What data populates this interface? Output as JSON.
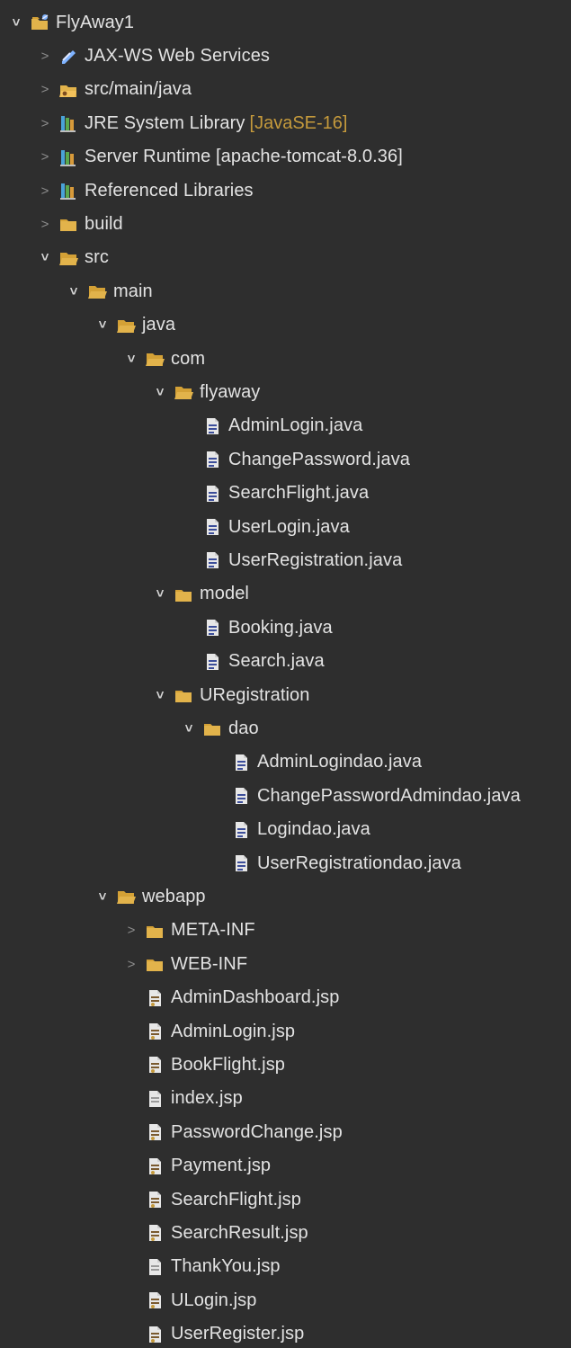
{
  "colors": {
    "background": "#2e2e2e",
    "text": "#e3e3e3",
    "decoration": "#c59a3c",
    "folder": "#e2b34b",
    "java_file": "#2f3f8f",
    "jsp_file": "#7a5a2f"
  },
  "tree": [
    {
      "level": 0,
      "expander": "expanded",
      "icon": "project-icon",
      "label": "FlyAway1"
    },
    {
      "level": 1,
      "expander": "collapsed",
      "icon": "web-services-icon",
      "label": "JAX-WS Web Services"
    },
    {
      "level": 1,
      "expander": "collapsed",
      "icon": "source-folder-icon",
      "label": "src/main/java"
    },
    {
      "level": 1,
      "expander": "collapsed",
      "icon": "library-icon",
      "label": "JRE System Library",
      "suffix": "[JavaSE-16]"
    },
    {
      "level": 1,
      "expander": "collapsed",
      "icon": "library-icon",
      "label": "Server Runtime [apache-tomcat-8.0.36]"
    },
    {
      "level": 1,
      "expander": "collapsed",
      "icon": "library-icon",
      "label": "Referenced Libraries"
    },
    {
      "level": 1,
      "expander": "collapsed",
      "icon": "folder-icon",
      "label": "build"
    },
    {
      "level": 1,
      "expander": "expanded",
      "icon": "folder-open-icon",
      "label": "src"
    },
    {
      "level": 2,
      "expander": "expanded",
      "icon": "folder-open-icon",
      "label": "main"
    },
    {
      "level": 3,
      "expander": "expanded",
      "icon": "folder-open-icon",
      "label": "java"
    },
    {
      "level": 4,
      "expander": "expanded",
      "icon": "folder-open-icon",
      "label": "com"
    },
    {
      "level": 5,
      "expander": "expanded",
      "icon": "folder-open-icon",
      "label": "flyaway"
    },
    {
      "level": 6,
      "expander": "none",
      "icon": "java-file-icon",
      "label": "AdminLogin.java"
    },
    {
      "level": 6,
      "expander": "none",
      "icon": "java-file-icon",
      "label": "ChangePassword.java"
    },
    {
      "level": 6,
      "expander": "none",
      "icon": "java-file-icon",
      "label": "SearchFlight.java"
    },
    {
      "level": 6,
      "expander": "none",
      "icon": "java-file-icon",
      "label": "UserLogin.java"
    },
    {
      "level": 6,
      "expander": "none",
      "icon": "java-file-icon",
      "label": "UserRegistration.java"
    },
    {
      "level": 5,
      "expander": "expanded",
      "icon": "folder-icon",
      "label": "model"
    },
    {
      "level": 6,
      "expander": "none",
      "icon": "java-file-icon",
      "label": "Booking.java"
    },
    {
      "level": 6,
      "expander": "none",
      "icon": "java-file-icon",
      "label": "Search.java"
    },
    {
      "level": 5,
      "expander": "expanded",
      "icon": "folder-icon",
      "label": "URegistration"
    },
    {
      "level": 6,
      "expander": "expanded",
      "icon": "folder-icon",
      "label": "dao"
    },
    {
      "level": 7,
      "expander": "none",
      "icon": "java-file-icon",
      "label": "AdminLogindao.java"
    },
    {
      "level": 7,
      "expander": "none",
      "icon": "java-file-icon",
      "label": "ChangePasswordAdmindao.java"
    },
    {
      "level": 7,
      "expander": "none",
      "icon": "java-file-icon",
      "label": "Logindao.java"
    },
    {
      "level": 7,
      "expander": "none",
      "icon": "java-file-icon",
      "label": "UserRegistrationdao.java"
    },
    {
      "level": 3,
      "expander": "expanded",
      "icon": "folder-open-icon",
      "label": "webapp"
    },
    {
      "level": 4,
      "expander": "collapsed",
      "icon": "folder-icon",
      "label": "META-INF"
    },
    {
      "level": 4,
      "expander": "collapsed",
      "icon": "folder-icon",
      "label": "WEB-INF"
    },
    {
      "level": 4,
      "expander": "none",
      "icon": "jsp-file-icon",
      "label": "AdminDashboard.jsp"
    },
    {
      "level": 4,
      "expander": "none",
      "icon": "jsp-file-icon",
      "label": "AdminLogin.jsp"
    },
    {
      "level": 4,
      "expander": "none",
      "icon": "jsp-file-icon",
      "label": "BookFlight.jsp"
    },
    {
      "level": 4,
      "expander": "none",
      "icon": "file-icon",
      "label": "index.jsp"
    },
    {
      "level": 4,
      "expander": "none",
      "icon": "jsp-file-icon",
      "label": "PasswordChange.jsp"
    },
    {
      "level": 4,
      "expander": "none",
      "icon": "jsp-file-icon",
      "label": "Payment.jsp"
    },
    {
      "level": 4,
      "expander": "none",
      "icon": "jsp-file-icon",
      "label": "SearchFlight.jsp"
    },
    {
      "level": 4,
      "expander": "none",
      "icon": "jsp-file-icon",
      "label": "SearchResult.jsp"
    },
    {
      "level": 4,
      "expander": "none",
      "icon": "file-icon",
      "label": "ThankYou.jsp"
    },
    {
      "level": 4,
      "expander": "none",
      "icon": "jsp-file-icon",
      "label": "ULogin.jsp"
    },
    {
      "level": 4,
      "expander": "none",
      "icon": "jsp-file-icon",
      "label": "UserRegister.jsp"
    }
  ]
}
